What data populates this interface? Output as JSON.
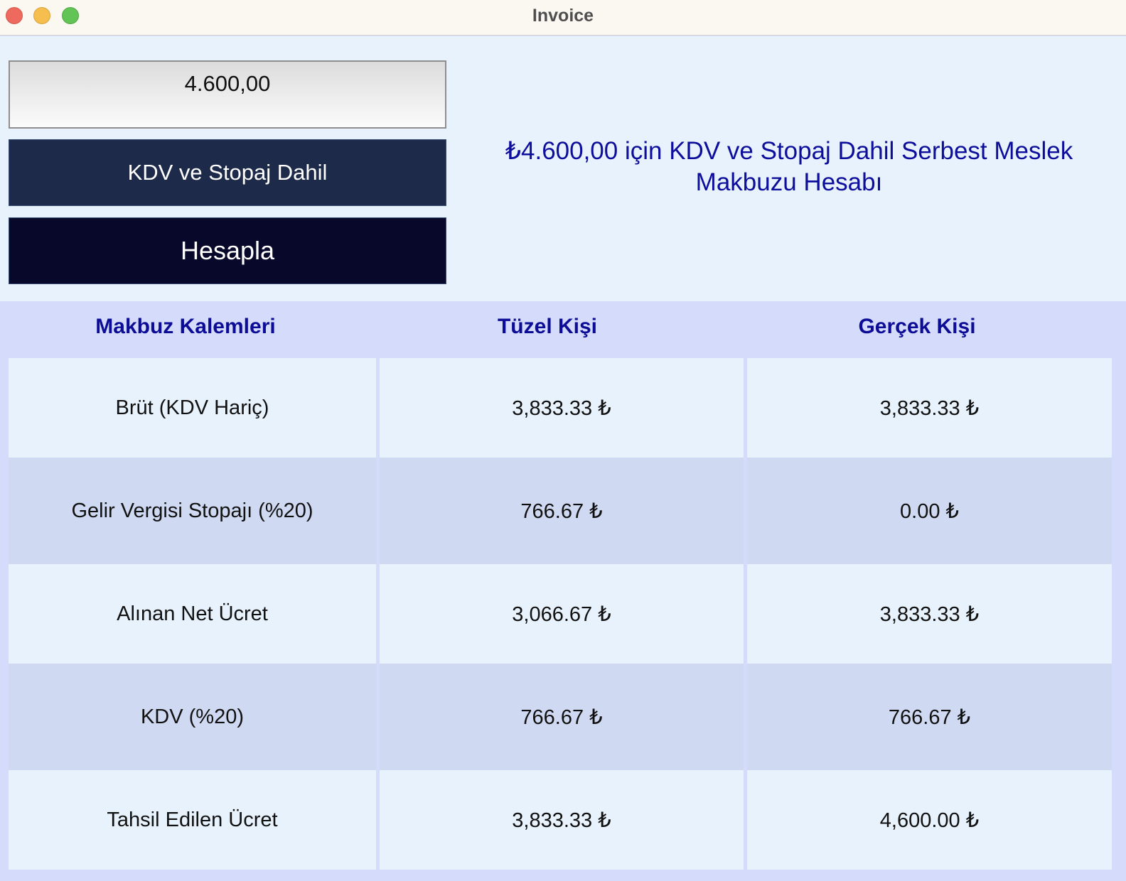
{
  "window": {
    "title": "Invoice"
  },
  "form": {
    "amount_value": "4.600,00",
    "mode_button_label": "KDV ve Stopaj Dahil",
    "calculate_button_label": "Hesapla"
  },
  "headline": "₺4.600,00 için KDV ve Stopaj Dahil Serbest Meslek Makbuzu Hesabı",
  "table": {
    "headers": [
      "Makbuz Kalemleri",
      "Tüzel Kişi",
      "Gerçek Kişi"
    ],
    "rows": [
      {
        "item": "Brüt (KDV Hariç)",
        "tuzel": "3,833.33 ₺",
        "gercek": "3,833.33 ₺"
      },
      {
        "item": "Gelir Vergisi Stopajı (%20)",
        "tuzel": "766.67 ₺",
        "gercek": "0.00 ₺"
      },
      {
        "item": "Alınan Net Ücret",
        "tuzel": "3,066.67 ₺",
        "gercek": "3,833.33 ₺"
      },
      {
        "item": "KDV (%20)",
        "tuzel": "766.67 ₺",
        "gercek": "766.67 ₺"
      },
      {
        "item": "Tahsil Edilen Ücret",
        "tuzel": "3,833.33 ₺",
        "gercek": "4,600.00 ₺"
      }
    ]
  },
  "colors": {
    "headline": "#0d0e9b",
    "mode_button": "#1e2a4a",
    "calculate_button": "#08092a",
    "table_header_text": "#0c0c97"
  }
}
